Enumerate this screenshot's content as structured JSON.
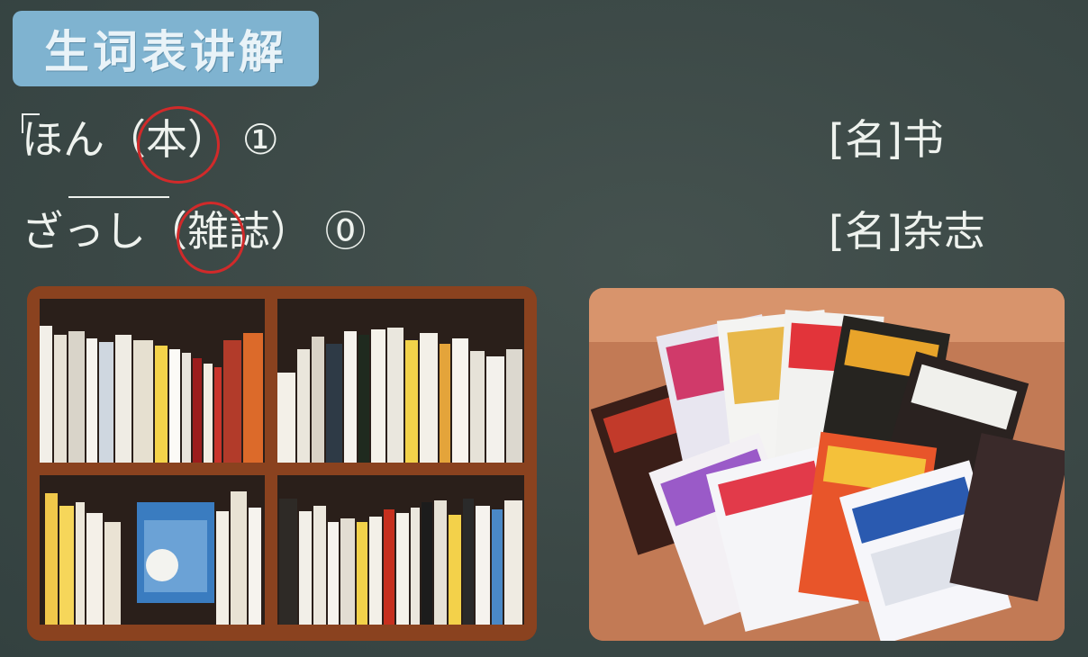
{
  "title": "生词表讲解",
  "vocab": [
    {
      "reading_pre": "ほん",
      "paren_open": "（",
      "kanji_circled": "本",
      "kanji_rest": "",
      "paren_close": "）",
      "accent": "①",
      "pos": "[名]",
      "meaning": "书"
    },
    {
      "reading_pre": "ざっし",
      "paren_open": "（",
      "kanji_circled": "雑",
      "kanji_rest": "誌",
      "paren_close": "）",
      "accent": "⓪",
      "pos": "[名]",
      "meaning": "杂志"
    }
  ],
  "colors": {
    "circle": "#d12a2a",
    "badge": "#7fb3d0",
    "background": "#3b4a48"
  },
  "images": [
    {
      "icon": "bookshelf-photo"
    },
    {
      "icon": "magazines-photo"
    }
  ]
}
